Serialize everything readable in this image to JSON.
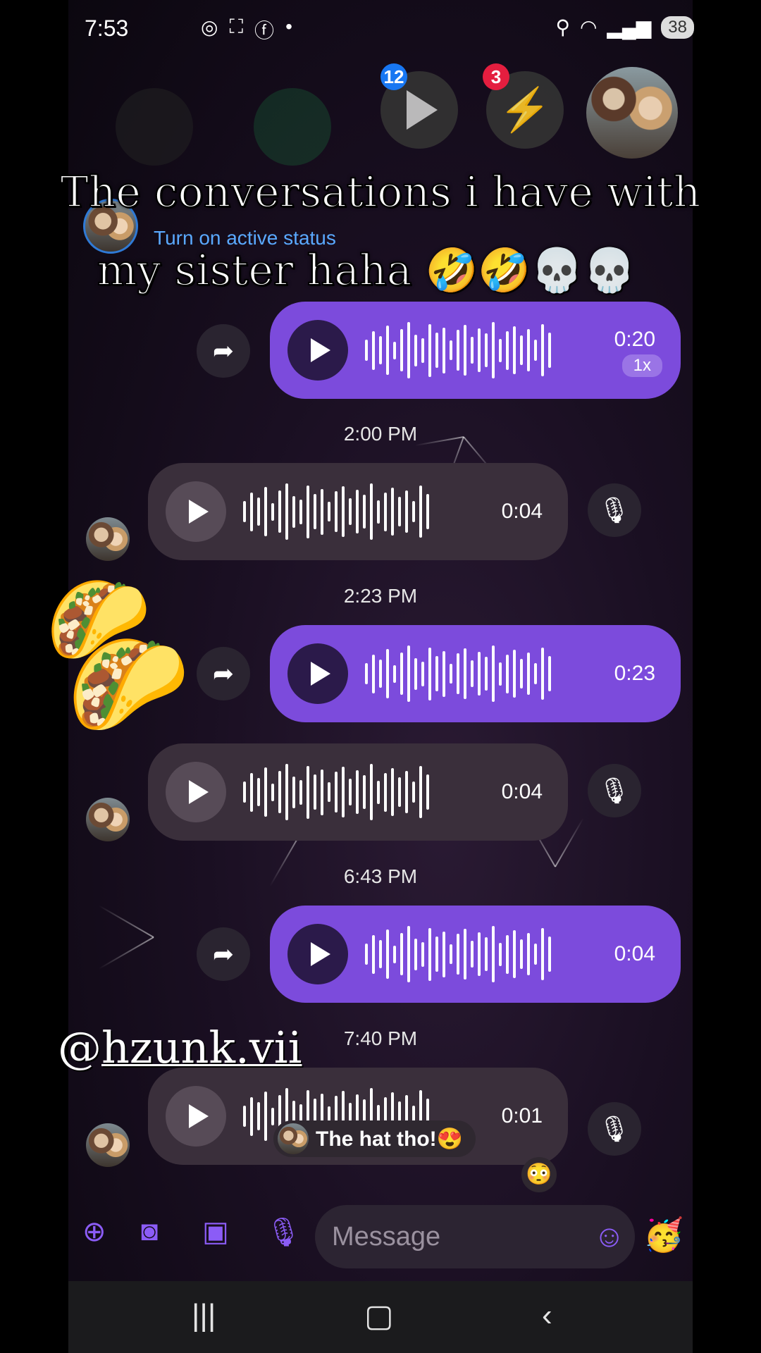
{
  "status_bar": {
    "time": "7:53",
    "left_icons": [
      "messenger-icon",
      "screenshot-icon",
      "facebook-icon",
      "dot"
    ],
    "right_icons": [
      "location-icon",
      "wifi-icon",
      "signal-icon"
    ],
    "battery": "38"
  },
  "chat_heads": {
    "badge_1": "12",
    "badge_2": "3"
  },
  "overlay": {
    "caption_line1": "The conversations i have with",
    "caption_line2": "my sister haha 🤣🤣💀💀",
    "handle_prefix": "@",
    "handle": "hzunk.vii"
  },
  "header": {
    "active_status": "Turn on active status"
  },
  "messages": [
    {
      "type": "sent",
      "duration": "0:20",
      "speed": "1x"
    },
    {
      "timestamp": "2:00 PM"
    },
    {
      "type": "received",
      "duration": "0:04"
    },
    {
      "timestamp": "2:23 PM"
    },
    {
      "type": "sent",
      "duration": "0:23"
    },
    {
      "type": "received",
      "duration": "0:04"
    },
    {
      "timestamp": "6:43 PM"
    },
    {
      "type": "sent",
      "duration": "0:04"
    },
    {
      "timestamp": "7:40 PM"
    },
    {
      "type": "received",
      "duration": "0:01"
    }
  ],
  "reaction_preview": {
    "text": "The hat tho!😍",
    "small_reaction": "😳"
  },
  "composer": {
    "placeholder": "Message"
  },
  "colors": {
    "sent_bubble": "#7c4bdc",
    "received_bubble": "#3a2f3b",
    "accent": "#8b5cf6"
  }
}
